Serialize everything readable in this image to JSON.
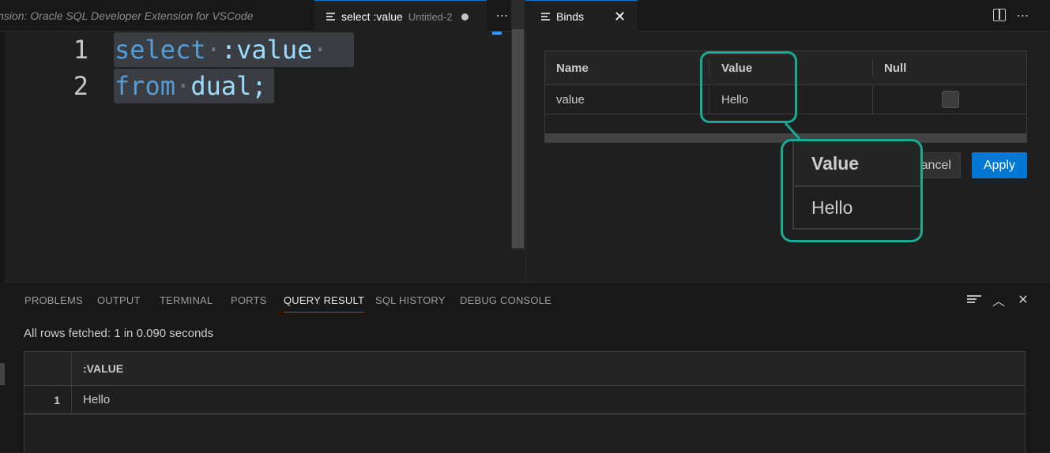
{
  "left_tabs": {
    "inactive_label": "Extension: Oracle SQL Developer Extension for VSCode",
    "active_label": "select :value",
    "active_sub": "Untitled-2"
  },
  "right_tabs": {
    "active_label": "Binds"
  },
  "editor": {
    "lines": [
      {
        "number": "1",
        "keyword": "select",
        "rest": ":value"
      },
      {
        "number": "2",
        "keyword": "from",
        "rest": "dual;"
      }
    ]
  },
  "binds": {
    "columns": [
      "Name",
      "Value",
      "Null"
    ],
    "row": {
      "name": "value",
      "value": "Hello"
    },
    "cancel_label": "Cancel",
    "apply_label": "Apply"
  },
  "callout": {
    "header": "Value",
    "value": "Hello"
  },
  "panel": {
    "tabs": [
      "PROBLEMS",
      "OUTPUT",
      "TERMINAL",
      "PORTS",
      "QUERY RESULT",
      "SQL HISTORY",
      "DEBUG CONSOLE"
    ],
    "active_tab": "QUERY RESULT",
    "status": "All rows fetched: 1 in 0.090 seconds",
    "result": {
      "column": ":VALUE",
      "rows": [
        {
          "index": "1",
          "value": "Hello"
        }
      ]
    }
  },
  "colors": {
    "accent": "#0078d4",
    "callout": "#1aab94"
  }
}
